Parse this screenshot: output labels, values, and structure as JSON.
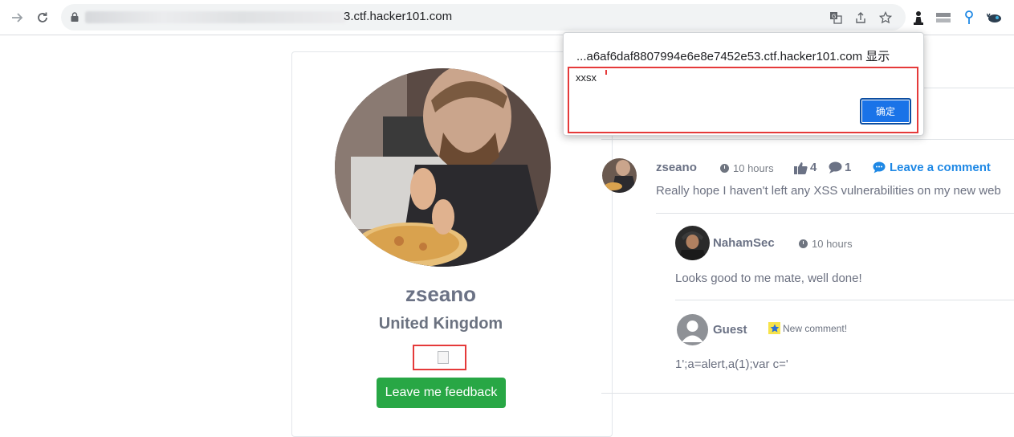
{
  "browser": {
    "url_suffix": "3.ctf.hacker101.com",
    "icons": [
      "forward-icon",
      "reload-icon",
      "lock-icon",
      "translate-icon",
      "share-icon",
      "bookmark-star-icon",
      "extension-chess-icon",
      "extension-bars-icon",
      "extension-pin-icon",
      "extension-whale-icon"
    ]
  },
  "alert": {
    "origin": "...a6af6daf8807994e6e8e7452e53.ctf.hacker101.com 显示",
    "message": "xxsx",
    "ok_label": "确定"
  },
  "profile": {
    "username": "zseano",
    "country": "United Kingdom",
    "feedback_label": "Leave me feedback"
  },
  "post": {
    "author": "zseano",
    "time": "10 hours",
    "likes": "4",
    "comments": "1",
    "leave_comment_label": "Leave a comment",
    "text": "Really hope I haven't left any XSS vulnerabilities on my new web"
  },
  "replies": [
    {
      "author": "NahamSec",
      "time": "10 hours",
      "text": "Looks good to me mate, well done!"
    },
    {
      "author": "Guest",
      "badge": "New comment!",
      "text": "1';a=alert,a(1);var c='"
    }
  ],
  "colors": {
    "accent_blue": "#1e88e5",
    "button_green": "#28a745",
    "highlight_red": "#e53a3a",
    "dialog_button": "#1a73e8"
  }
}
